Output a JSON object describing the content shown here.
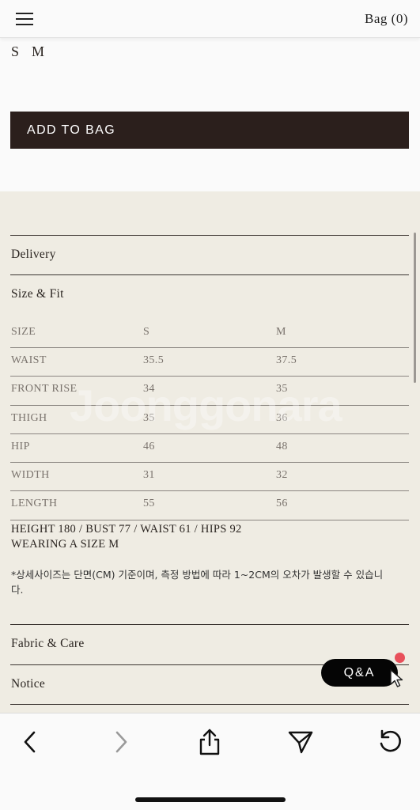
{
  "header": {
    "menu_icon": "hamburger-menu-icon",
    "bag_label": "Bag (0)"
  },
  "product": {
    "sizes": [
      "S",
      "M"
    ],
    "add_to_bag_label": "ADD TO BAG"
  },
  "sections": {
    "delivery": "Delivery",
    "size_fit": "Size & Fit",
    "fabric_care": "Fabric & Care",
    "notice": "Notice"
  },
  "size_table": {
    "headers": [
      "SIZE",
      "S",
      "M"
    ],
    "rows": [
      [
        "WAIST",
        "35.5",
        "37.5"
      ],
      [
        "FRONT RISE",
        "34",
        "35"
      ],
      [
        "THIGH",
        "35",
        "36"
      ],
      [
        "HIP",
        "46",
        "48"
      ],
      [
        "WIDTH",
        "31",
        "32"
      ],
      [
        "LENGTH",
        "55",
        "56"
      ]
    ]
  },
  "model_info": {
    "line1": "HEIGHT 180 / BUST 77 / WAIST 61 / HIPS 92",
    "line2": "WEARING A SIZE M"
  },
  "note": "*상세사이즈는 단면(CM) 기준이며, 측정 방법에 따라 1~2CM의 오차가 발생할 수 있습니다.",
  "watermark": "Joonggonara",
  "qa_button": "Q&A",
  "toolbar": {
    "icons": [
      "back-icon",
      "forward-icon",
      "share-icon",
      "send-icon",
      "reload-icon"
    ]
  },
  "colors": {
    "add_button_bg": "#2b1f1c",
    "page_bg": "#efece3",
    "qa_bg": "#050505",
    "qa_badge": "#e8505b"
  }
}
